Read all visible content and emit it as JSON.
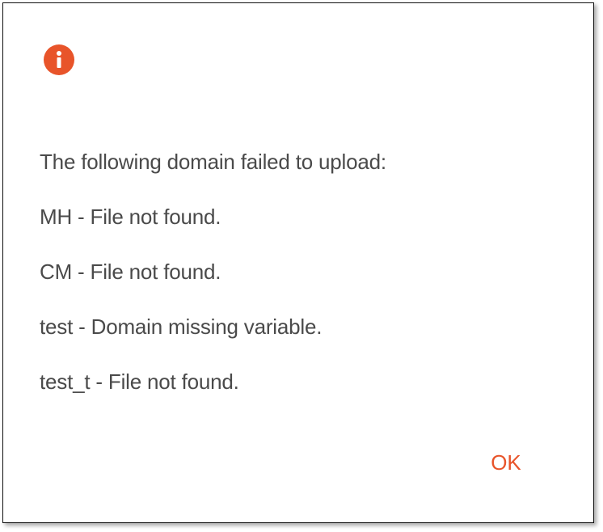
{
  "dialog": {
    "icon": "info-icon",
    "accent_color": "#e8542a",
    "messages": [
      "The following domain failed to upload:",
      "MH - File not found.",
      "CM - File not found.",
      "test - Domain missing variable.",
      "test_t - File not found."
    ],
    "ok_label": "OK"
  }
}
